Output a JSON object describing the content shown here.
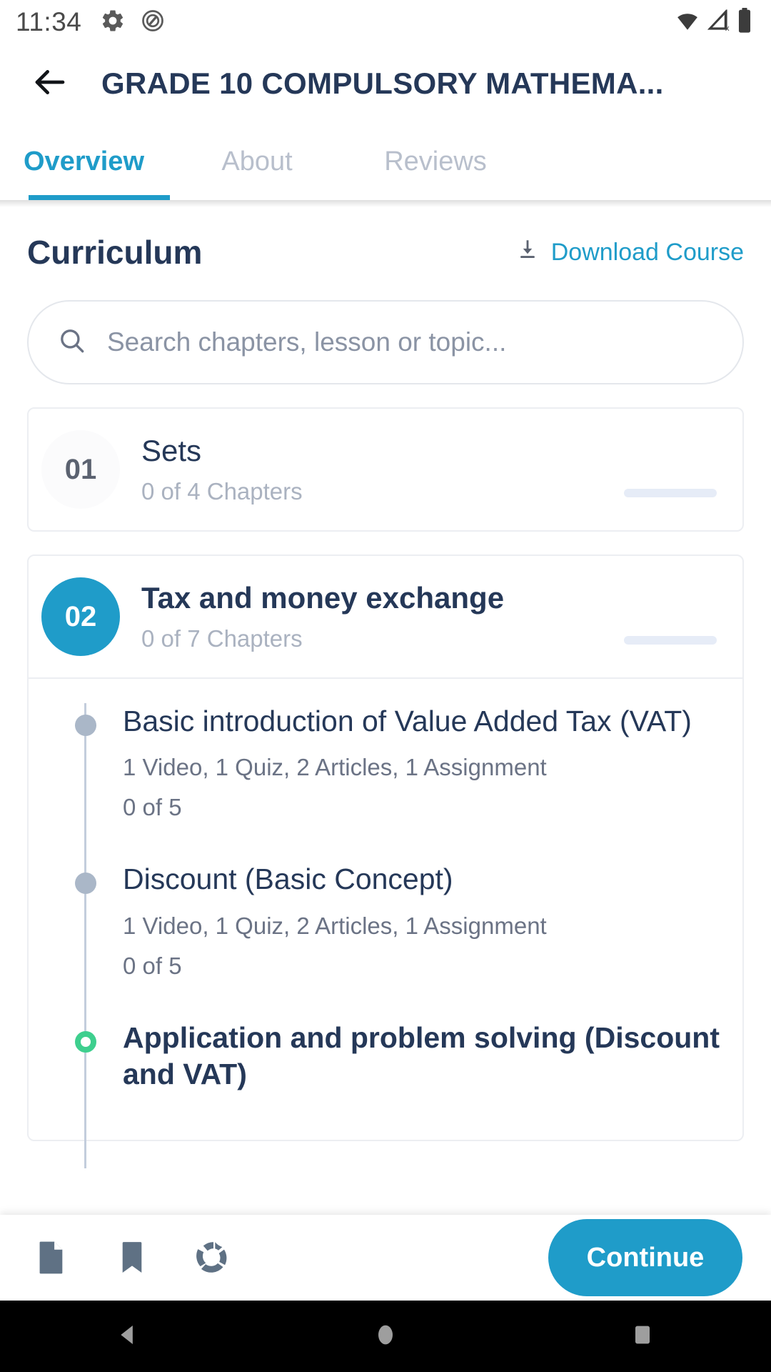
{
  "status_bar": {
    "time": "11:34",
    "left_icons": [
      "gear-icon",
      "screenshot-capture-icon"
    ],
    "right_icons": [
      "wifi-icon",
      "cellular-signal-off-icon",
      "battery-icon"
    ]
  },
  "app_bar": {
    "back_icon": "arrow-left-icon",
    "title": "GRADE 10 COMPULSORY MATHEMA..."
  },
  "tabs": {
    "items": [
      {
        "label": "Overview",
        "active": true
      },
      {
        "label": "About",
        "active": false
      },
      {
        "label": "Reviews",
        "active": false
      }
    ],
    "active_color": "#1f9cc9",
    "inactive_color": "#b8bfcc"
  },
  "curriculum": {
    "title": "Curriculum",
    "download": {
      "label": "Download Course",
      "icon": "download-icon",
      "color": "#1f9cc9"
    }
  },
  "search": {
    "icon": "search-icon",
    "placeholder": "Search chapters, lesson or topic...",
    "value": ""
  },
  "chapters": [
    {
      "number": "01",
      "title": "Sets",
      "subtitle": "0 of 4 Chapters",
      "active": false
    },
    {
      "number": "02",
      "title": "Tax and money exchange",
      "subtitle": "0 of 7 Chapters",
      "active": true,
      "lessons": [
        {
          "title": "Basic introduction of Value Added Tax (VAT)",
          "meta": "1 Video, 1 Quiz, 2 Articles, 1 Assignment",
          "count": "0 of 5",
          "state": "done"
        },
        {
          "title": "Discount (Basic Concept)",
          "meta": "1 Video, 1 Quiz, 2 Articles, 1 Assignment",
          "count": "0 of 5",
          "state": "done"
        },
        {
          "title": "Application and problem solving (Discount and VAT)",
          "meta": "",
          "count": "",
          "state": "current"
        }
      ]
    }
  ],
  "bottom_bar": {
    "icons": [
      "file-document-icon",
      "bookmark-icon",
      "progress-donut-icon"
    ],
    "continue_label": "Continue",
    "continue_color": "#1f9cc9"
  },
  "android_nav": {
    "back": "nav-back-icon",
    "home": "nav-home-icon",
    "recents": "nav-recents-icon"
  },
  "colors": {
    "accent": "#1f9cc9",
    "title": "#253858",
    "muted": "#aab2c0",
    "green": "#3ecf8e"
  }
}
